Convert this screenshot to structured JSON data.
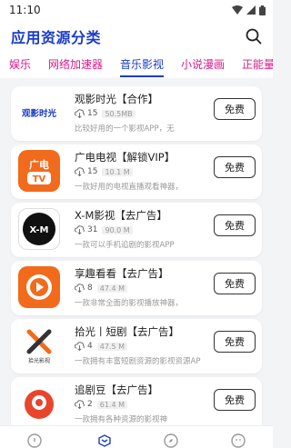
{
  "status": {
    "time": "11:10"
  },
  "header": {
    "title": "应用资源分类"
  },
  "tabs": [
    {
      "label": "娱乐"
    },
    {
      "label": "网络加速器"
    },
    {
      "label": "音乐影视",
      "active": true
    },
    {
      "label": "小说漫画"
    },
    {
      "label": "正能量"
    }
  ],
  "apps": [
    {
      "name": "观影时光【合作】",
      "downloads": "15",
      "size": "50.5MB",
      "desc": "比较好用的一个影视APP，无",
      "icon": "guanying-logo-icon",
      "button": "免费"
    },
    {
      "name": "广电电视【解锁VIP】",
      "downloads": "15",
      "size": "10.1 M",
      "desc": "一款好用的电视直播观看神器，",
      "icon": "guangdian-tv-icon",
      "button": "免费"
    },
    {
      "name": "X-M影视【去广告】",
      "downloads": "31",
      "size": "90.0 M",
      "desc": "一款可以手机追剧的影视APP",
      "icon": "xm-logo-icon",
      "button": "免费"
    },
    {
      "name": "享趣看看【去广告】",
      "downloads": "8",
      "size": "47.4 M",
      "desc": "一款非常全面的影视播放神器，",
      "icon": "xiangqu-play-icon",
      "button": "免费"
    },
    {
      "name": "拾光丨短剧【去广告】",
      "downloads": "4",
      "size": "47.5 M",
      "desc": "一款拥有丰富短剧资源的影视资源AP",
      "icon": "shiguang-film-icon",
      "button": "免费"
    },
    {
      "name": "追剧豆【去广告】",
      "downloads": "2",
      "size": "61.4 M",
      "desc": "一款拥有各种资源的影视神",
      "icon": "zhuijudou-icon",
      "button": "免费"
    }
  ],
  "logo_text": {
    "guanying": "观影时光",
    "guangdian_top": "广电",
    "guangdian_bottom": "TV",
    "xm": "X-M",
    "shiguang": "拾光影视"
  },
  "colors": {
    "accent": "#1a3cc8",
    "tab_text": "#d81b8a",
    "orange": "#f26a1b"
  }
}
